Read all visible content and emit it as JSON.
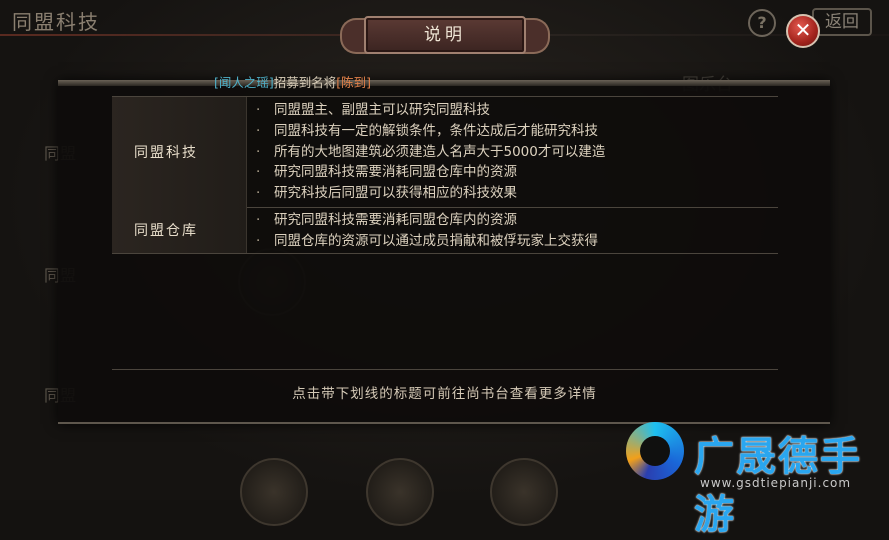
{
  "background": {
    "title": "同盟科技",
    "help_label": "?",
    "back_label": "返回",
    "rows": [
      "同盟",
      "同盟",
      "同盟"
    ],
    "side_panel_title": "图乐台"
  },
  "dialog": {
    "title": "说明",
    "close_glyph": "✕",
    "news": {
      "hero_name": "[闻人之瑶]",
      "middle_text": "招募到名将",
      "general_name": "[陈到]"
    },
    "sections": [
      {
        "label": "同盟科技",
        "items": [
          "同盟盟主、副盟主可以研究同盟科技",
          "同盟科技有一定的解锁条件，条件达成后才能研究科技",
          "所有的大地图建筑必须建造人名声大于5000才可以建造",
          "研究同盟科技需要消耗同盟仓库中的资源",
          "研究科技后同盟可以获得相应的科技效果"
        ]
      },
      {
        "label": "同盟仓库",
        "items": [
          "研究同盟科技需要消耗同盟仓库内的资源",
          "同盟仓库的资源可以通过成员捐献和被俘玩家上交获得"
        ]
      }
    ],
    "footer_note": "点击带下划线的标题可前往尚书台查看更多详情"
  },
  "watermark": {
    "brand": "广晟德手游",
    "url": "www.gsdtiepianji.com"
  },
  "colors": {
    "hero_name": "#4fb0c8",
    "general_name": "#e0814a",
    "close_button": "#c0302a",
    "watermark_text": "#2aa6ef"
  }
}
